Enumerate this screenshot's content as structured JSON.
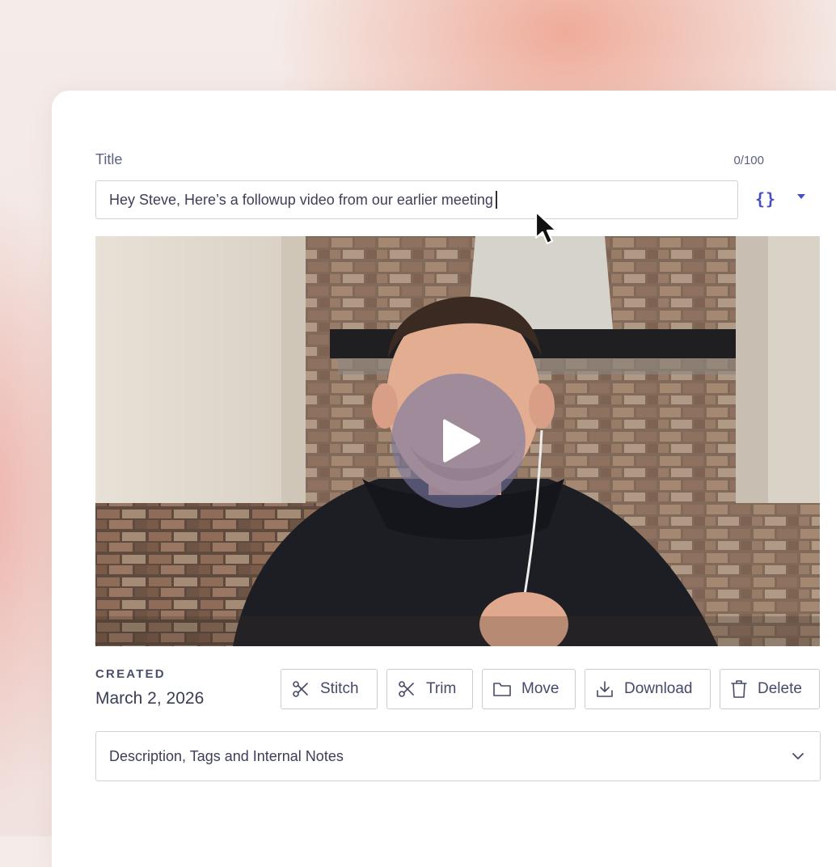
{
  "form": {
    "title_label": "Title",
    "char_count": "0/100",
    "title_value": "Hey Steve, Here’s a followup video from our earlier meeting",
    "variables_label": "{}"
  },
  "video": {
    "play_icon": "play-icon"
  },
  "meta": {
    "created_label": "CREATED",
    "created_date": "March 2, 2026"
  },
  "actions": {
    "stitch": "Stitch",
    "trim": "Trim",
    "move": "Move",
    "download": "Download",
    "delete": "Delete"
  },
  "details": {
    "label": "Description, Tags and Internal Notes"
  },
  "colors": {
    "accent": "#4a4fbf",
    "text": "#3b3f58",
    "border": "#cfd2dc",
    "background_peach": "#eea08c"
  }
}
